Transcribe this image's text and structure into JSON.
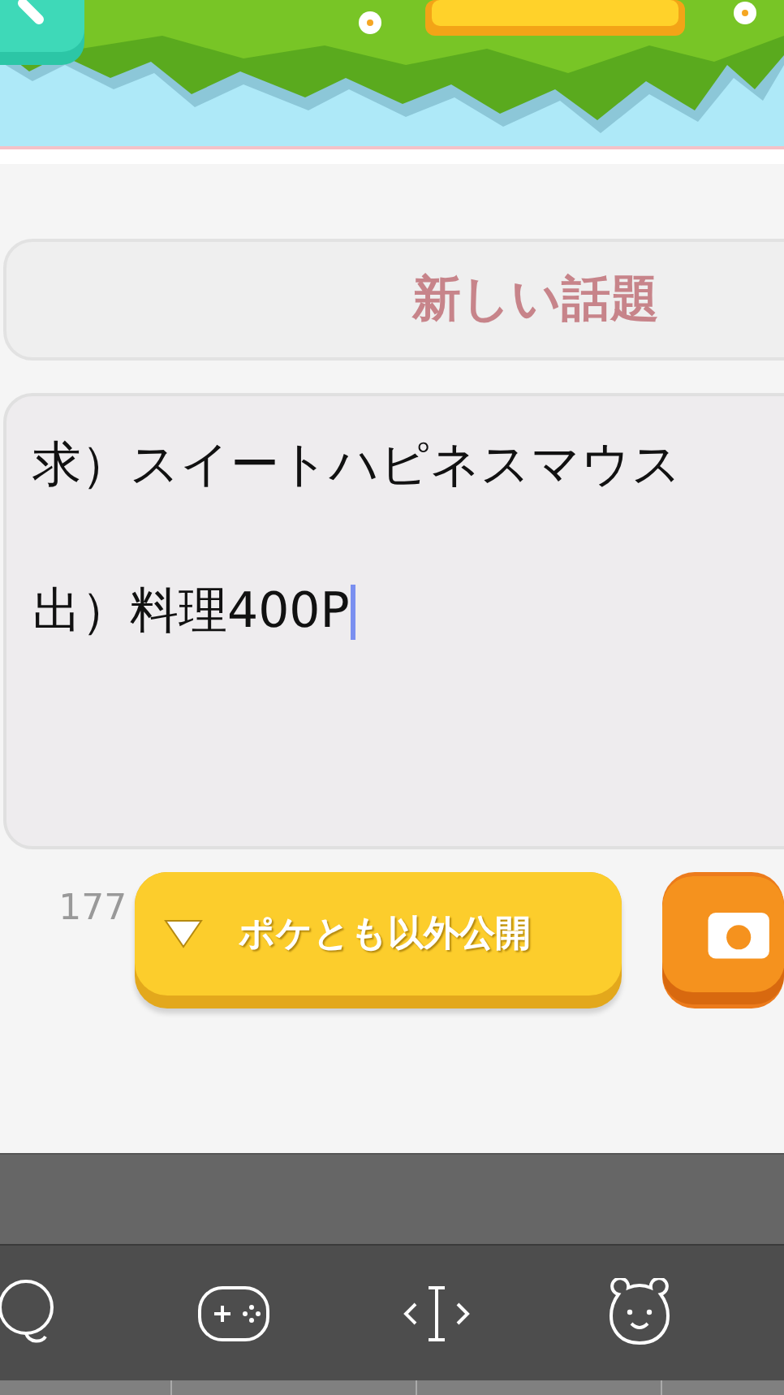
{
  "topic_field": {
    "placeholder": "新しい話題"
  },
  "body_field": {
    "lines": [
      "求）スイートハピネスマウス",
      "出）料理400P"
    ],
    "focused": true
  },
  "char_count": "177",
  "visibility_button": {
    "label": "ポケとも以外公開"
  },
  "tab_bar": {
    "items": [
      {
        "kind": "chat"
      },
      {
        "kind": "game"
      },
      {
        "kind": "text"
      },
      {
        "kind": "bear"
      }
    ]
  }
}
